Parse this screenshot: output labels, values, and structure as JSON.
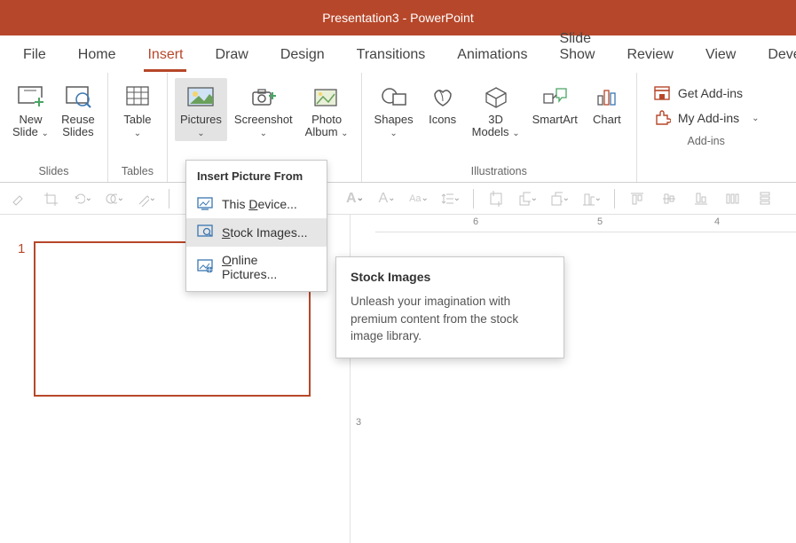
{
  "titlebar": {
    "text": "Presentation3  -  PowerPoint"
  },
  "tabs": [
    "File",
    "Home",
    "Insert",
    "Draw",
    "Design",
    "Transitions",
    "Animations",
    "Slide Show",
    "Review",
    "View",
    "Develo"
  ],
  "active_tab_index": 2,
  "ribbon": {
    "slides_group": {
      "label": "Slides",
      "new_slide": "New\nSlide",
      "reuse_slides": "Reuse\nSlides"
    },
    "tables_group": {
      "label": "Tables",
      "table": "Table"
    },
    "images_group": {
      "pictures": "Pictures",
      "screenshot": "Screenshot",
      "photo_album": "Photo\nAlbum"
    },
    "illustrations_group": {
      "label": "Illustrations",
      "shapes": "Shapes",
      "icons": "Icons",
      "models": "3D\nModels",
      "smartart": "SmartArt",
      "chart": "Chart"
    },
    "addins_group": {
      "label": "Add-ins",
      "get": "Get Add-ins",
      "my": "My Add-ins"
    }
  },
  "dropdown": {
    "title": "Insert Picture From",
    "items": [
      {
        "icon": "device-icon",
        "pre": "This ",
        "u": "D",
        "post": "evice..."
      },
      {
        "icon": "stock-icon",
        "pre": "",
        "u": "S",
        "post": "tock Images..."
      },
      {
        "icon": "online-icon",
        "pre": "",
        "u": "O",
        "post": "nline Pictures..."
      }
    ],
    "hover_index": 1
  },
  "tooltip": {
    "title": "Stock Images",
    "body": "Unleash your imagination with premium content from the stock image library."
  },
  "thumb": {
    "number": "1"
  },
  "ruler_h": [
    "6",
    "5",
    "4"
  ],
  "ruler_v": [
    "3"
  ]
}
